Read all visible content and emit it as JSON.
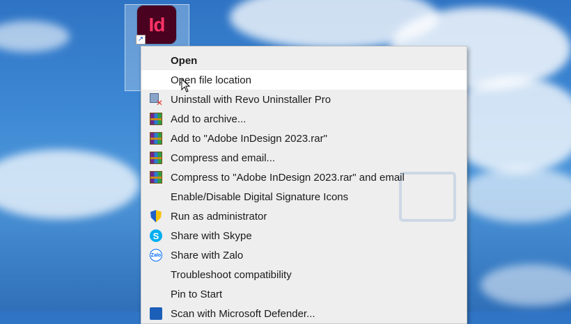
{
  "desktop": {
    "shortcut_icon_text": "Id",
    "shortcut_arrow": "arrow-shortcut-icon"
  },
  "context_menu": {
    "items": [
      {
        "label": "Open",
        "bold": true,
        "icon": "none"
      },
      {
        "label": "Open file location",
        "highlighted": true,
        "icon": "none"
      },
      {
        "label": "Uninstall with Revo Uninstaller Pro",
        "icon": "revo-uninstaller-icon"
      },
      {
        "label": "Add to archive...",
        "icon": "winrar-icon"
      },
      {
        "label": "Add to \"Adobe InDesign 2023.rar\"",
        "icon": "winrar-icon"
      },
      {
        "label": "Compress and email...",
        "icon": "winrar-icon"
      },
      {
        "label": "Compress to \"Adobe InDesign 2023.rar\" and email",
        "icon": "winrar-icon"
      },
      {
        "label": "Enable/Disable Digital Signature Icons",
        "icon": "none"
      },
      {
        "label": "Run as administrator",
        "icon": "uac-shield-icon"
      },
      {
        "label": "Share with Skype",
        "icon": "skype-icon"
      },
      {
        "label": "Share with Zalo",
        "icon": "zalo-icon"
      },
      {
        "label": "Troubleshoot compatibility",
        "icon": "none"
      },
      {
        "label": "Pin to Start",
        "icon": "none"
      },
      {
        "label": "Scan with Microsoft Defender...",
        "icon": "defender-icon"
      }
    ]
  },
  "icon_glyphs": {
    "skype": "S",
    "zalo": "Zalo"
  },
  "colors": {
    "menu_bg": "#eeeeee",
    "menu_highlight": "#ffffff",
    "indesign_bg": "#49021f",
    "indesign_text": "#ff3366"
  }
}
